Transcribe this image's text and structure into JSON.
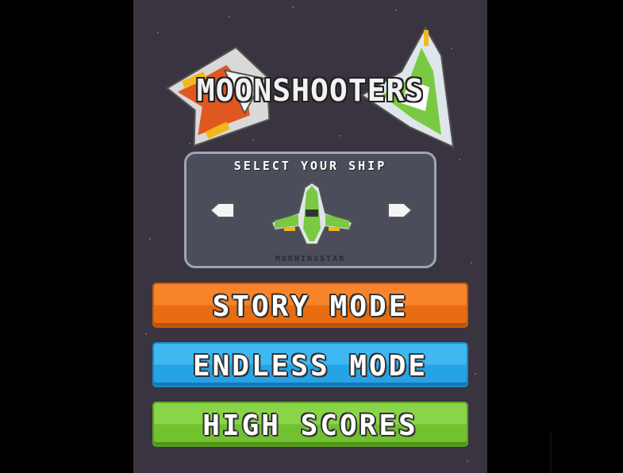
{
  "game": {
    "title": "MOONSHOOTERS",
    "ship_select": {
      "heading": "SELECT YOUR SHIP",
      "ship_name": "MORNINGSTAR",
      "prev_icon": "arrow-left-icon",
      "next_icon": "arrow-right-icon"
    },
    "buttons": {
      "story_mode": "STORY MODE",
      "endless_mode": "ENDLESS MODE",
      "high_scores": "HIGH SCORES"
    },
    "colors": {
      "background": "#3a3440",
      "story": "#f7842a",
      "endless": "#3fb7f0",
      "scores": "#8ad44a",
      "panel": "#4b4e5a"
    }
  }
}
